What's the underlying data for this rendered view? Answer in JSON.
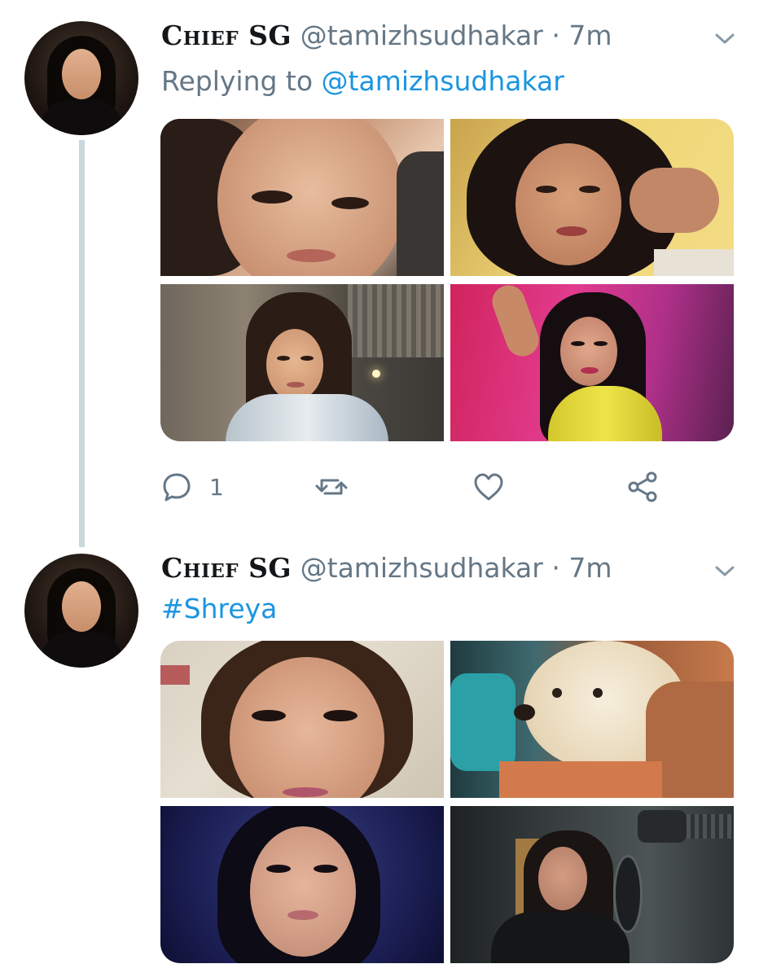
{
  "tweets": [
    {
      "display_name": "Chief SG",
      "handle": "@tamizhsudhakar",
      "separator": "·",
      "time": "7m",
      "replying_prefix": "Replying to",
      "replying_to": "@tamizhsudhakar",
      "reply_count": "1"
    },
    {
      "display_name": "Chief SG",
      "handle": "@tamizhsudhakar",
      "separator": "·",
      "time": "7m",
      "hashtag": "#Shreya"
    }
  ],
  "icons": {
    "reply": "reply-icon",
    "retweet": "retweet-icon",
    "like": "like-icon",
    "share": "share-icon",
    "menu": "chevron-down-icon"
  },
  "colors": {
    "link": "#1b95e0",
    "muted": "#657786",
    "thread_line": "#ccd6dd"
  }
}
